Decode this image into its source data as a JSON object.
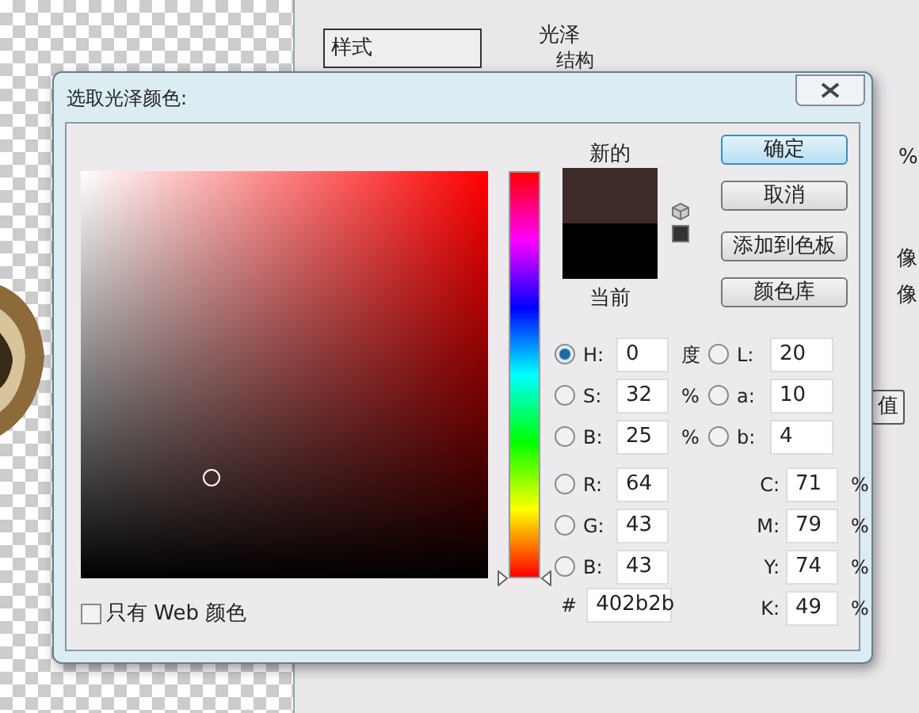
{
  "background": {
    "style_list": [
      "样式"
    ],
    "section_title": "光泽",
    "group_title": "结构",
    "labels": [
      "%",
      "像",
      "像"
    ],
    "button": "值"
  },
  "dialog": {
    "title": "选取光泽颜色:",
    "hue_marker": {
      "level": 0
    },
    "swatch": {
      "new_label": "新的",
      "current_label": "当前"
    },
    "buttons": [
      {
        "label": "确定",
        "default": true
      },
      {
        "label": "取消",
        "default": false
      },
      {
        "label": "添加到色板",
        "default": false
      },
      {
        "label": "颜色库",
        "default": false
      }
    ],
    "hsb": [
      {
        "label": "H:",
        "value": "0",
        "unit": "度",
        "selected": true
      },
      {
        "label": "S:",
        "value": "32",
        "unit": "%",
        "selected": false
      },
      {
        "label": "B:",
        "value": "25",
        "unit": "%",
        "selected": false
      }
    ],
    "lab": [
      {
        "label": "L:",
        "value": "20",
        "selected": false
      },
      {
        "label": "a:",
        "value": "10",
        "selected": false
      },
      {
        "label": "b:",
        "value": "4",
        "selected": false
      }
    ],
    "rgb": [
      {
        "label": "R:",
        "value": "64",
        "selected": false
      },
      {
        "label": "G:",
        "value": "43",
        "selected": false
      },
      {
        "label": "B:",
        "value": "43",
        "selected": false
      }
    ],
    "cmyk": [
      {
        "label": "C:",
        "value": "71",
        "unit": "%"
      },
      {
        "label": "M:",
        "value": "79",
        "unit": "%"
      },
      {
        "label": "Y:",
        "value": "74",
        "unit": "%"
      },
      {
        "label": "K:",
        "value": "49",
        "unit": "%"
      }
    ],
    "hex": {
      "label": "#",
      "value": "402b2b"
    },
    "web_only": {
      "label": "只有 Web 颜色",
      "checked": false
    }
  }
}
